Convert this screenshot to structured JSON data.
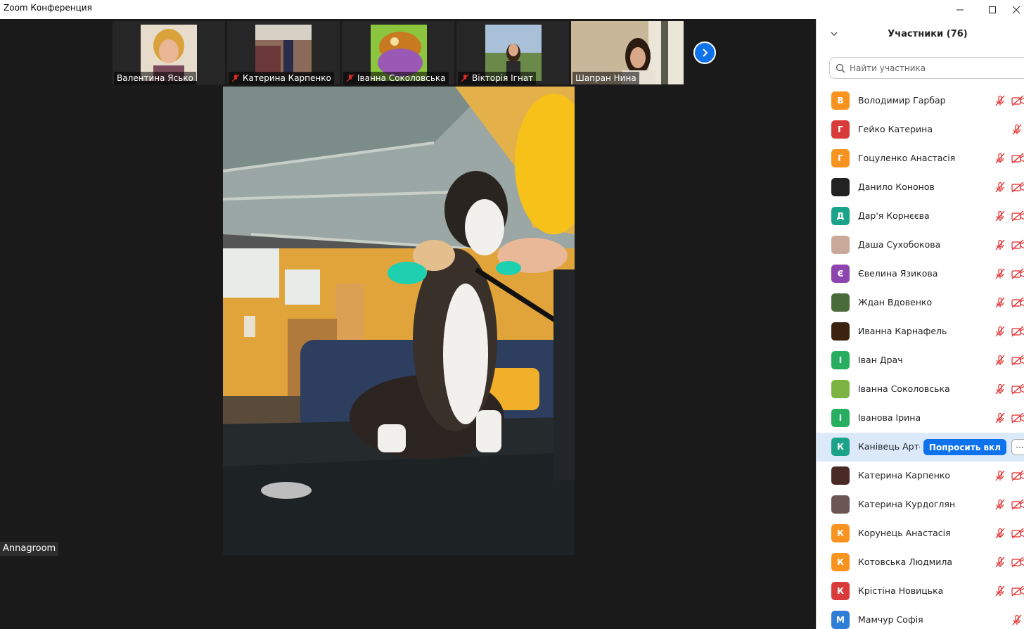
{
  "window": {
    "title": "Zoom Конференция"
  },
  "thumbnails": [
    {
      "name": "Валентина Ясько",
      "muted": false
    },
    {
      "name": "Катерина Карпенко",
      "muted": true
    },
    {
      "name": "Іванна Соколовська",
      "muted": true
    },
    {
      "name": "Вікторія Ігнат",
      "muted": true
    },
    {
      "name": "Шапран Нина",
      "muted": false
    }
  ],
  "speaker": {
    "name": "Annagroom"
  },
  "panel": {
    "title": "Участники (76)",
    "search_placeholder": "Найти участника",
    "ask_button": "Попросить вкл",
    "more_button": "···"
  },
  "participants": [
    {
      "name": "Володимир Гарбар",
      "initial": "В",
      "color": "#f7931e"
    },
    {
      "name": "Гейко Катерина",
      "initial": "Г",
      "color": "#d93a3a",
      "camera": false
    },
    {
      "name": "Гоцуленко Анастасія",
      "initial": "Г",
      "color": "#f7931e"
    },
    {
      "name": "Данило Кононов",
      "initial": "",
      "color": "#222222"
    },
    {
      "name": "Дар'я Корнєєва",
      "initial": "Д",
      "color": "#1aa388"
    },
    {
      "name": "Даша Сухобокова",
      "initial": "",
      "color": "#c9a99a"
    },
    {
      "name": "Євелина Язикова",
      "initial": "Є",
      "color": "#8e44ad"
    },
    {
      "name": "Ждан Вдовенко",
      "initial": "",
      "color": "#4a6b3a"
    },
    {
      "name": "Иванна Карнафель",
      "initial": "",
      "color": "#3a2410"
    },
    {
      "name": "Іван Драч",
      "initial": "І",
      "color": "#27ae60"
    },
    {
      "name": "Іванна Соколовська",
      "initial": "",
      "color": "#7cb342"
    },
    {
      "name": "Іванова Ірина",
      "initial": "І",
      "color": "#27ae60"
    },
    {
      "name": "Канівець Артем",
      "initial": "К",
      "color": "#1aa388",
      "highlighted": true
    },
    {
      "name": "Катерина Карпенко",
      "initial": "",
      "color": "#4a2a24"
    },
    {
      "name": "Катерина Курдоглян",
      "initial": "",
      "color": "#6b5555"
    },
    {
      "name": "Корунець Анастасія",
      "initial": "К",
      "color": "#f7931e"
    },
    {
      "name": "Котовська Людмила",
      "initial": "К",
      "color": "#f7931e"
    },
    {
      "name": "Крістіна Новицька",
      "initial": "К",
      "color": "#d93a3a"
    },
    {
      "name": "Мамчур Софія",
      "initial": "М",
      "color": "#2e7dd6",
      "camera": false
    }
  ]
}
